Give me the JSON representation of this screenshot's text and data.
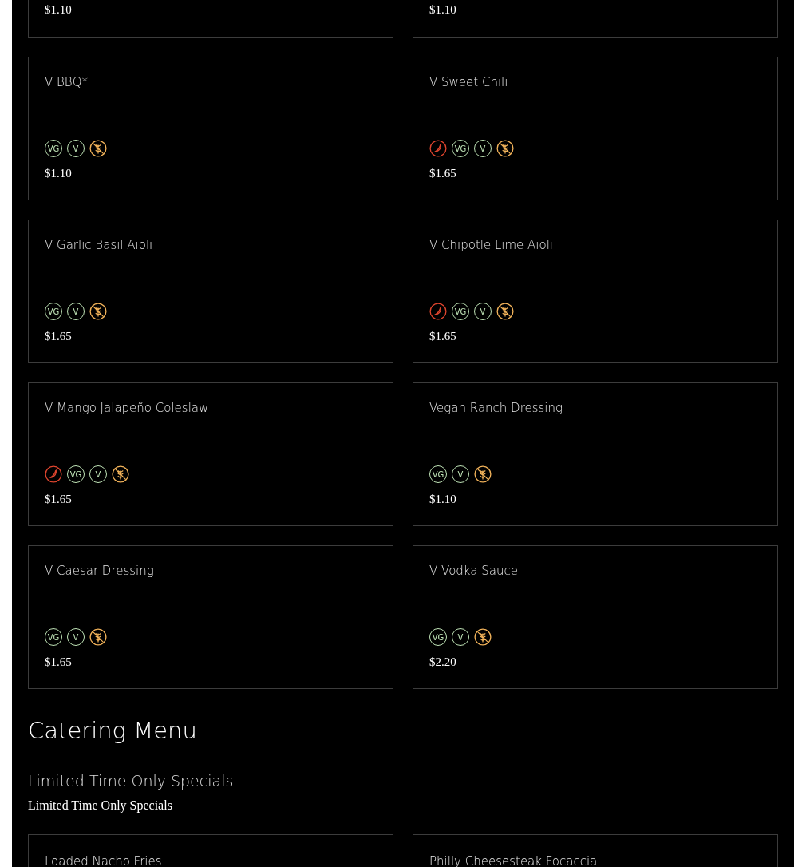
{
  "top_cards": [
    {
      "price": "$1.10"
    },
    {
      "price": "$1.10"
    }
  ],
  "items": [
    {
      "name": "V BBQ*",
      "tags": [
        {
          "kind": "vegan",
          "label": "VG"
        },
        {
          "kind": "vegetarian",
          "label": "V"
        },
        {
          "kind": "gluten_free"
        }
      ],
      "price": "$1.10"
    },
    {
      "name": "V Sweet Chili",
      "tags": [
        {
          "kind": "spicy"
        },
        {
          "kind": "vegan",
          "label": "VG"
        },
        {
          "kind": "vegetarian",
          "label": "V"
        },
        {
          "kind": "gluten_free"
        }
      ],
      "price": "$1.65"
    },
    {
      "name": "V Garlic Basil Aioli",
      "tags": [
        {
          "kind": "vegan",
          "label": "VG"
        },
        {
          "kind": "vegetarian",
          "label": "V"
        },
        {
          "kind": "gluten_free"
        }
      ],
      "price": "$1.65"
    },
    {
      "name": "V Chipotle Lime Aioli",
      "tags": [
        {
          "kind": "spicy"
        },
        {
          "kind": "vegan",
          "label": "VG"
        },
        {
          "kind": "vegetarian",
          "label": "V"
        },
        {
          "kind": "gluten_free"
        }
      ],
      "price": "$1.65"
    },
    {
      "name": "V Mango Jalapeño Coleslaw",
      "tags": [
        {
          "kind": "spicy"
        },
        {
          "kind": "vegan",
          "label": "VG"
        },
        {
          "kind": "vegetarian",
          "label": "V"
        },
        {
          "kind": "gluten_free"
        }
      ],
      "price": "$1.65"
    },
    {
      "name": "Vegan Ranch Dressing",
      "tags": [
        {
          "kind": "vegan",
          "label": "VG"
        },
        {
          "kind": "vegetarian",
          "label": "V"
        },
        {
          "kind": "gluten_free"
        }
      ],
      "price": "$1.10"
    },
    {
      "name": "V Caesar Dressing",
      "tags": [
        {
          "kind": "vegan",
          "label": "VG"
        },
        {
          "kind": "vegetarian",
          "label": "V"
        },
        {
          "kind": "gluten_free"
        }
      ],
      "price": "$1.65"
    },
    {
      "name": "V Vodka Sauce",
      "tags": [
        {
          "kind": "vegan",
          "label": "VG"
        },
        {
          "kind": "vegetarian",
          "label": "V"
        },
        {
          "kind": "gluten_free"
        }
      ],
      "price": "$2.20"
    }
  ],
  "menu_title": "Catering Menu",
  "section": {
    "title": "Limited Time Only Specials",
    "description": "Limited Time Only Specials"
  },
  "bottom_cards": [
    {
      "name": "Loaded Nacho Fries"
    },
    {
      "name": "Philly Cheesesteak Focaccia"
    }
  ]
}
